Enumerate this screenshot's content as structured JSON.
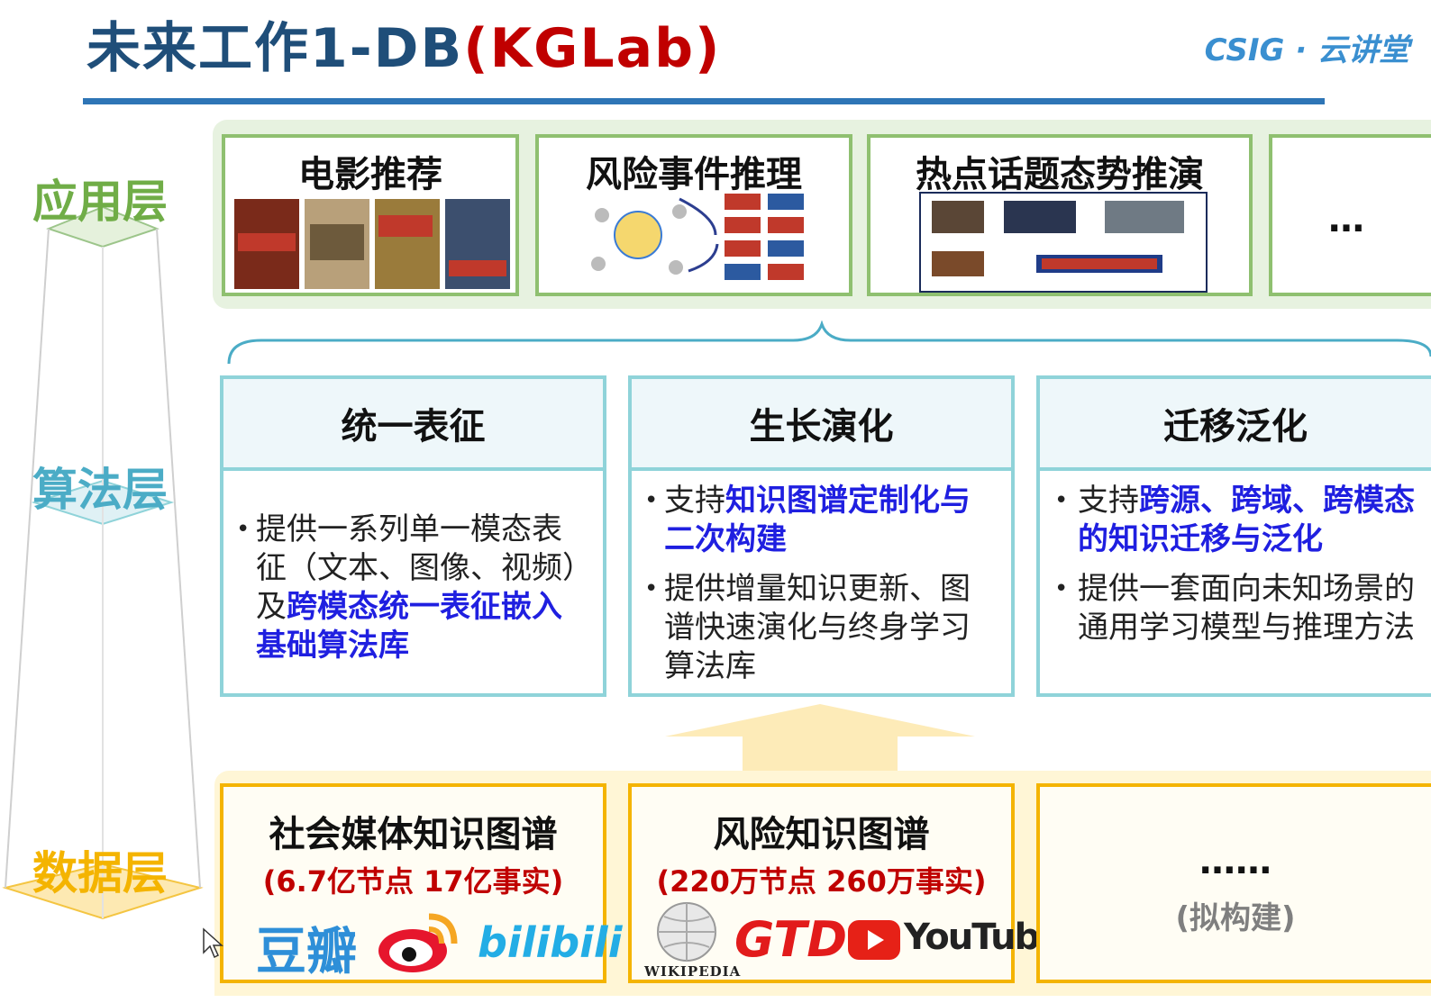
{
  "header": {
    "title_main": "未来工作1-DB",
    "title_paren": "(KGLab)",
    "brand": "CSIG · 云讲堂"
  },
  "layers": {
    "application": "应用层",
    "algorithm": "算法层",
    "data": "数据层"
  },
  "applications": [
    {
      "title": "电影推荐"
    },
    {
      "title": "风险事件推理"
    },
    {
      "title": "热点话题态势推演"
    },
    {
      "title": "…"
    }
  ],
  "algorithms": [
    {
      "title": "统一表征"
    },
    {
      "title": "生长演化"
    },
    {
      "title": "迁移泛化"
    }
  ],
  "algo_text": {
    "a1_b1_plain": "提供一系列单一模态表征（文本、图像、视频）及",
    "a1_b1_hl": "跨模态统一表征嵌入基础算法库",
    "a2_b1_plain": "支持",
    "a2_b1_hl": "知识图谱定制化与二次构建",
    "a2_b2_plain": "提供增量知识更新、图谱快速演化与终身学习算法库",
    "a3_b1_plain": "支持",
    "a3_b1_hl": "跨源、跨域、跨模态的知识迁移与泛化",
    "a3_b2_plain": "提供一套面向未知场景的通用学习模型与推理方法"
  },
  "datasets": [
    {
      "title": "社会媒体知识图谱",
      "stats": "(6.7亿节点 17亿事实)"
    },
    {
      "title": "风险知识图谱",
      "stats": "(220万节点 260万事实)"
    },
    {
      "title": "……",
      "stats": "(拟构建)"
    }
  ],
  "logos": {
    "douban": "豆瓣",
    "bilibili": "bilibili",
    "gtd": "GTD",
    "youtube": "YouTube",
    "wikipedia": "Wikipedia"
  },
  "colors": {
    "title_blue": "#1f4e79",
    "title_red": "#c00000",
    "highlight_blue": "#1f1fe0",
    "app_green": "#70ad47",
    "algo_teal": "#4bacc6",
    "data_gold": "#f4b400"
  }
}
